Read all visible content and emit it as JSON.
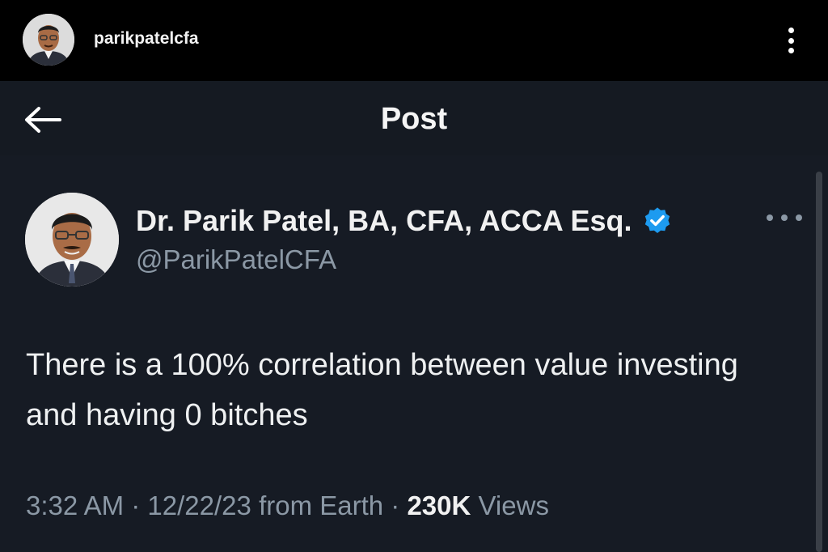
{
  "instagram": {
    "username": "parikpatelcfa",
    "avatar": "profile-photo",
    "more_icon": "vertical-dots-icon"
  },
  "header": {
    "back_icon": "arrow-left-icon",
    "title": "Post"
  },
  "post": {
    "author": {
      "name": "Dr. Parik Patel, BA, CFA, ACCA Esq.",
      "handle": "@ParikPatelCFA",
      "verified_icon": "verified-badge-icon",
      "verified_color": "#1d9bf0"
    },
    "more_icon": "horizontal-dots-icon",
    "text": "There is a 100% correlation between value investing and having 0 bitches",
    "time": "3:32 AM",
    "date": "12/22/23",
    "source": "from Earth",
    "views_count": "230K",
    "views_label": "Views"
  },
  "colors": {
    "background": "#161b24",
    "top_bar": "#000000",
    "secondary_text": "#8b98a5"
  }
}
